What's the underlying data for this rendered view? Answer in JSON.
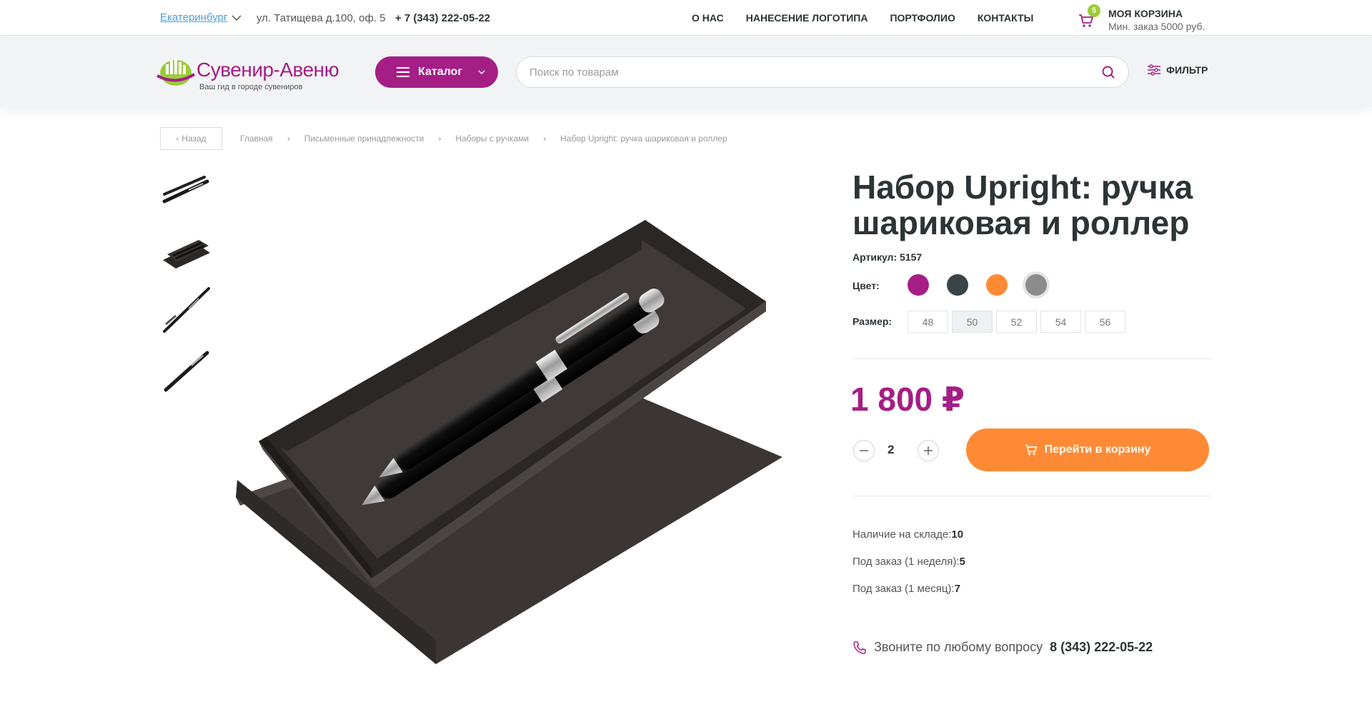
{
  "topbar": {
    "city": "Екатеринбург",
    "address": "ул. Татищева д.100, оф. 5",
    "phone": "+ 7 (343) 222-05-22",
    "nav": [
      "О НАС",
      "НАНЕСЕНИЕ ЛОГОТИПА",
      "ПОРТФОЛИО",
      "КОНТАКТЫ"
    ],
    "cart_count": "5",
    "cart_title": "МОЯ КОРЗИНА",
    "cart_min": "Мин. заказ 5000 руб."
  },
  "header": {
    "logo_text": "Сувенир-Авеню",
    "logo_tagline": "Ваш гид в городе сувениров",
    "catalog_label": "Каталог",
    "search_placeholder": "Поиск по товарам",
    "filter_label": "ФИЛЬТР"
  },
  "breadcrumb": {
    "back": "Назад",
    "items": [
      "Главная",
      "Письменные принадлежности",
      "Наборы с ручками",
      "Набор Upright: ручка шариковая и роллер"
    ]
  },
  "product": {
    "title": "Набор Upright: ручка шариковая и роллер",
    "sku": "Артикул: 5157",
    "color_label": "Цвет:",
    "colors": [
      "#a51e86",
      "#3a4446",
      "#ff8a36",
      "#8c8c8c"
    ],
    "selected_color_index": 3,
    "size_label": "Размер:",
    "sizes": [
      "48",
      "50",
      "52",
      "54",
      "56"
    ],
    "active_size_index": 1,
    "price": "1 800 ₽",
    "quantity": "2",
    "cart_button": "Перейти в корзину",
    "stock": [
      {
        "label": "Наличие на складе:",
        "value": "10"
      },
      {
        "label": "Под заказ (1 неделя):",
        "value": "5"
      },
      {
        "label": "Под заказ (1 месяц):",
        "value": "7"
      }
    ],
    "call_text": "Звоните по любому вопросу",
    "call_phone": "8 (343) 222-05-22"
  },
  "colors": {
    "brand": "#a51e86",
    "accent": "#ff8a36",
    "badge": "#9bcb3b",
    "link": "#4d9fd6"
  }
}
